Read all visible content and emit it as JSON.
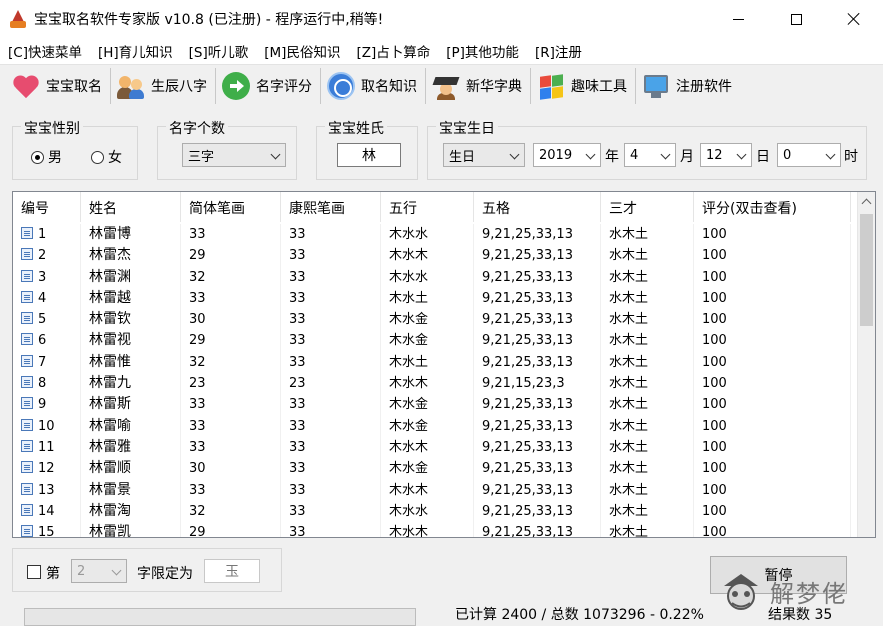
{
  "window": {
    "title": "宝宝取名软件专家版 v10.8 (已注册) - 程序运行中,稍等!"
  },
  "menu": [
    "[C]快速菜单",
    "[H]育儿知识",
    "[S]听儿歌",
    "[M]民俗知识",
    "[Z]占卜算命",
    "[P]其他功能",
    "[R]注册"
  ],
  "toolbar": [
    {
      "label": "宝宝取名",
      "icon": "heart-icon"
    },
    {
      "label": "生辰八字",
      "icon": "people-icon"
    },
    {
      "label": "名字评分",
      "icon": "green-arrow-icon"
    },
    {
      "label": "取名知识",
      "icon": "globe-icon"
    },
    {
      "label": "新华字典",
      "icon": "graduate-icon"
    },
    {
      "label": "趣味工具",
      "icon": "windows-logo-icon"
    },
    {
      "label": "注册软件",
      "icon": "monitor-icon"
    }
  ],
  "gender": {
    "legend": "宝宝性别",
    "options": [
      "男",
      "女"
    ],
    "selected": "男"
  },
  "name_count": {
    "legend": "名字个数",
    "value": "三字"
  },
  "surname": {
    "legend": "宝宝姓氏",
    "value": "林"
  },
  "birthday": {
    "legend": "宝宝生日",
    "calendar": "生日",
    "year": "2019",
    "year_unit": "年",
    "month": "4",
    "month_unit": "月",
    "day": "12",
    "day_unit": "日",
    "hour": "0",
    "hour_unit": "时"
  },
  "table": {
    "columns": [
      "编号",
      "姓名",
      "简体笔画",
      "康熙笔画",
      "五行",
      "五格",
      "三才",
      "评分(双击查看)"
    ],
    "rows": [
      [
        "1",
        "林雷博",
        "33",
        "33",
        "木水水",
        "9,21,25,33,13",
        "水木土",
        "100"
      ],
      [
        "2",
        "林雷杰",
        "29",
        "33",
        "木水木",
        "9,21,25,33,13",
        "水木土",
        "100"
      ],
      [
        "3",
        "林雷渊",
        "32",
        "33",
        "木水水",
        "9,21,25,33,13",
        "水木土",
        "100"
      ],
      [
        "4",
        "林雷越",
        "33",
        "33",
        "木水土",
        "9,21,25,33,13",
        "水木土",
        "100"
      ],
      [
        "5",
        "林雷钦",
        "30",
        "33",
        "木水金",
        "9,21,25,33,13",
        "水木土",
        "100"
      ],
      [
        "6",
        "林雷视",
        "29",
        "33",
        "木水金",
        "9,21,25,33,13",
        "水木土",
        "100"
      ],
      [
        "7",
        "林雷惟",
        "32",
        "33",
        "木水土",
        "9,21,25,33,13",
        "水木土",
        "100"
      ],
      [
        "8",
        "林雷九",
        "23",
        "23",
        "木水木",
        "9,21,15,23,3",
        "水木土",
        "100"
      ],
      [
        "9",
        "林雷斯",
        "33",
        "33",
        "木水金",
        "9,21,25,33,13",
        "水木土",
        "100"
      ],
      [
        "10",
        "林雷喻",
        "33",
        "33",
        "木水金",
        "9,21,25,33,13",
        "水木土",
        "100"
      ],
      [
        "11",
        "林雷雅",
        "33",
        "33",
        "木水木",
        "9,21,25,33,13",
        "水木土",
        "100"
      ],
      [
        "12",
        "林雷顺",
        "30",
        "33",
        "木水金",
        "9,21,25,33,13",
        "水木土",
        "100"
      ],
      [
        "13",
        "林雷景",
        "33",
        "33",
        "木水木",
        "9,21,25,33,13",
        "水木土",
        "100"
      ],
      [
        "14",
        "林雷淘",
        "32",
        "33",
        "木水水",
        "9,21,25,33,13",
        "水木土",
        "100"
      ],
      [
        "15",
        "林雷凯",
        "29",
        "33",
        "木水木",
        "9,21,25,33,13",
        "水木土",
        "100"
      ]
    ]
  },
  "filter": {
    "prefix": "第",
    "position": "2",
    "suffix": "字限定为",
    "char": "玉"
  },
  "pause_button": "暂停",
  "status": {
    "computed": "已计算 2400 / 总数 1073296 - 0.22%",
    "results": "结果数 35"
  },
  "watermark": "解梦佬"
}
